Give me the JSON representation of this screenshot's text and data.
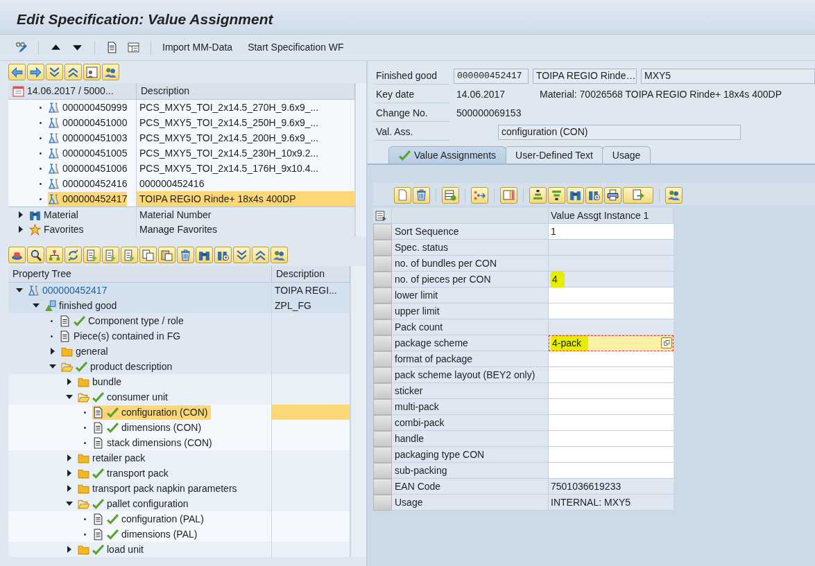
{
  "window": {
    "title": "Edit Specification: Value Assignment"
  },
  "toolbar": {
    "buttons": [
      {
        "label": "Import MM-Data"
      },
      {
        "label": "Start Specification WF"
      }
    ]
  },
  "hit_list": {
    "columns": [
      "14.06.2017 / 5000...",
      "Description"
    ],
    "rows": [
      {
        "number": "000000450999",
        "description": "PCS_MXY5_TOI_2x14.5_270H_9.6x9_...",
        "selected": false
      },
      {
        "number": "000000451000",
        "description": "PCS_MXY5_TOI_2x14.5_250H_9.6x9_...",
        "selected": false
      },
      {
        "number": "000000451003",
        "description": "PCS_MXY5_TOI_2x14.5_200H_9.6x9_...",
        "selected": false
      },
      {
        "number": "000000451005",
        "description": "PCS_MXY5_TOI_2x14.5_230H_10x9.2...",
        "selected": false
      },
      {
        "number": "000000451006",
        "description": "PCS_MXY5_TOI_2x14.5_176H_9x10.4...",
        "selected": false
      },
      {
        "number": "000000452416",
        "description": "000000452416",
        "selected": false
      },
      {
        "number": "000000452417",
        "description": "TOIPA REGIO Rinde+ 18x4s 400DP",
        "selected": true
      }
    ],
    "nodes": [
      {
        "label": "Material",
        "description": "Material Number",
        "kind": "binoculars",
        "expanded": false
      },
      {
        "label": "Favorites",
        "description": "Manage Favorites",
        "kind": "star",
        "expanded": false
      }
    ]
  },
  "property_tree": {
    "columns": [
      "Property Tree",
      "Description"
    ],
    "nodes": [
      {
        "label": "000000452417",
        "kind": "specification",
        "description": "TOIPA REGI...",
        "expanded": true,
        "checked": false,
        "selected": false,
        "children": [
          {
            "label": "finished good",
            "kind": "class",
            "description": "ZPL_FG",
            "expanded": true,
            "checked": false,
            "selected": false,
            "children": [
              {
                "label": "Component type / role",
                "kind": "document",
                "checked": true,
                "selected": false
              },
              {
                "label": "Piece(s) contained in FG",
                "kind": "document",
                "checked": false,
                "selected": false
              },
              {
                "label": "general",
                "kind": "folder",
                "expanded": false,
                "checked": false,
                "selected": false
              },
              {
                "label": "product description",
                "kind": "folder",
                "expanded": true,
                "checked": true,
                "selected": false,
                "children": [
                  {
                    "label": "bundle",
                    "kind": "folder",
                    "expanded": false,
                    "checked": false,
                    "selected": false
                  },
                  {
                    "label": "consumer unit",
                    "kind": "folder",
                    "expanded": true,
                    "checked": true,
                    "selected": false,
                    "children": [
                      {
                        "label": "configuration (CON)",
                        "kind": "document",
                        "checked": true,
                        "selected": true
                      },
                      {
                        "label": "dimensions (CON)",
                        "kind": "document",
                        "checked": true,
                        "selected": false
                      },
                      {
                        "label": "stack dimensions (CON)",
                        "kind": "document",
                        "checked": false,
                        "selected": false
                      }
                    ]
                  },
                  {
                    "label": "retailer pack",
                    "kind": "folder",
                    "expanded": false,
                    "checked": false,
                    "selected": false
                  },
                  {
                    "label": "transport pack",
                    "kind": "folder",
                    "expanded": false,
                    "checked": true,
                    "selected": false
                  },
                  {
                    "label": "transport pack napkin parameters",
                    "kind": "folder",
                    "expanded": false,
                    "checked": false,
                    "selected": false
                  },
                  {
                    "label": "pallet configuration",
                    "kind": "folder",
                    "expanded": true,
                    "checked": true,
                    "selected": false,
                    "children": [
                      {
                        "label": "configuration (PAL)",
                        "kind": "document",
                        "checked": true,
                        "selected": false
                      },
                      {
                        "label": "dimensions (PAL)",
                        "kind": "document",
                        "checked": true,
                        "selected": false
                      }
                    ]
                  },
                  {
                    "label": "load unit",
                    "kind": "folder",
                    "expanded": false,
                    "checked": true,
                    "selected": false
                  }
                ]
              }
            ]
          }
        ]
      }
    ]
  },
  "header": {
    "finished_good": {
      "label": "Finished good",
      "values": [
        "000000452417",
        "TOIPA REGIO Rinde…",
        "MXY5"
      ]
    },
    "key_date": {
      "label": "Key date",
      "value": "14.06.2017",
      "material": "Material: 70026568 TOIPA REGIO Rinde+ 18x4s 400DP"
    },
    "change_no": {
      "label": "Change No.",
      "value": "500000069153"
    },
    "val_ass": {
      "label": "Val. Ass.",
      "value": "configuration (CON)"
    }
  },
  "tabs": [
    {
      "label": "Value Assignments",
      "selected": true,
      "checked": true
    },
    {
      "label": "User-Defined Text",
      "selected": false,
      "checked": false
    },
    {
      "label": "Usage",
      "selected": false,
      "checked": false
    }
  ],
  "value_grid": {
    "column": "Value Assgt Instance 1",
    "rows": [
      {
        "label": "Sort Sequence",
        "value": "1",
        "editable": true,
        "highlighted": false,
        "focused": false
      },
      {
        "label": "Spec. status",
        "editable": false,
        "highlighted": false,
        "focused": false
      },
      {
        "label": "no. of bundles per CON",
        "editable": false,
        "highlighted": false,
        "focused": false
      },
      {
        "label": "no. of pieces per CON",
        "value": "4",
        "editable": false,
        "highlighted": true,
        "focused": false
      },
      {
        "label": "lower limit",
        "editable": true,
        "highlighted": false,
        "focused": false
      },
      {
        "label": "upper limit",
        "editable": true,
        "highlighted": false,
        "focused": false
      },
      {
        "label": "Pack count",
        "editable": false,
        "highlighted": false,
        "focused": false
      },
      {
        "label": "package scheme",
        "value": "4-pack",
        "editable": true,
        "highlighted": true,
        "focused": true
      },
      {
        "label": "format of package",
        "editable": true,
        "highlighted": false,
        "focused": false
      },
      {
        "label": "pack scheme layout (BEY2 only)",
        "editable": true,
        "highlighted": false,
        "focused": false
      },
      {
        "label": "sticker",
        "editable": true,
        "highlighted": false,
        "focused": false
      },
      {
        "label": "multi-pack",
        "editable": true,
        "highlighted": false,
        "focused": false
      },
      {
        "label": "combi-pack",
        "editable": true,
        "highlighted": false,
        "focused": false
      },
      {
        "label": "handle",
        "editable": true,
        "highlighted": false,
        "focused": false
      },
      {
        "label": "packaging type CON",
        "editable": true,
        "highlighted": false,
        "focused": false
      },
      {
        "label": "sub-packing",
        "editable": true,
        "highlighted": false,
        "focused": false
      },
      {
        "label": "EAN Code",
        "value": "7501036619233",
        "editable": false,
        "highlighted": false,
        "focused": false
      },
      {
        "label": "Usage",
        "value": "INTERNAL: MXY5",
        "editable": false,
        "highlighted": false,
        "focused": false
      }
    ]
  }
}
